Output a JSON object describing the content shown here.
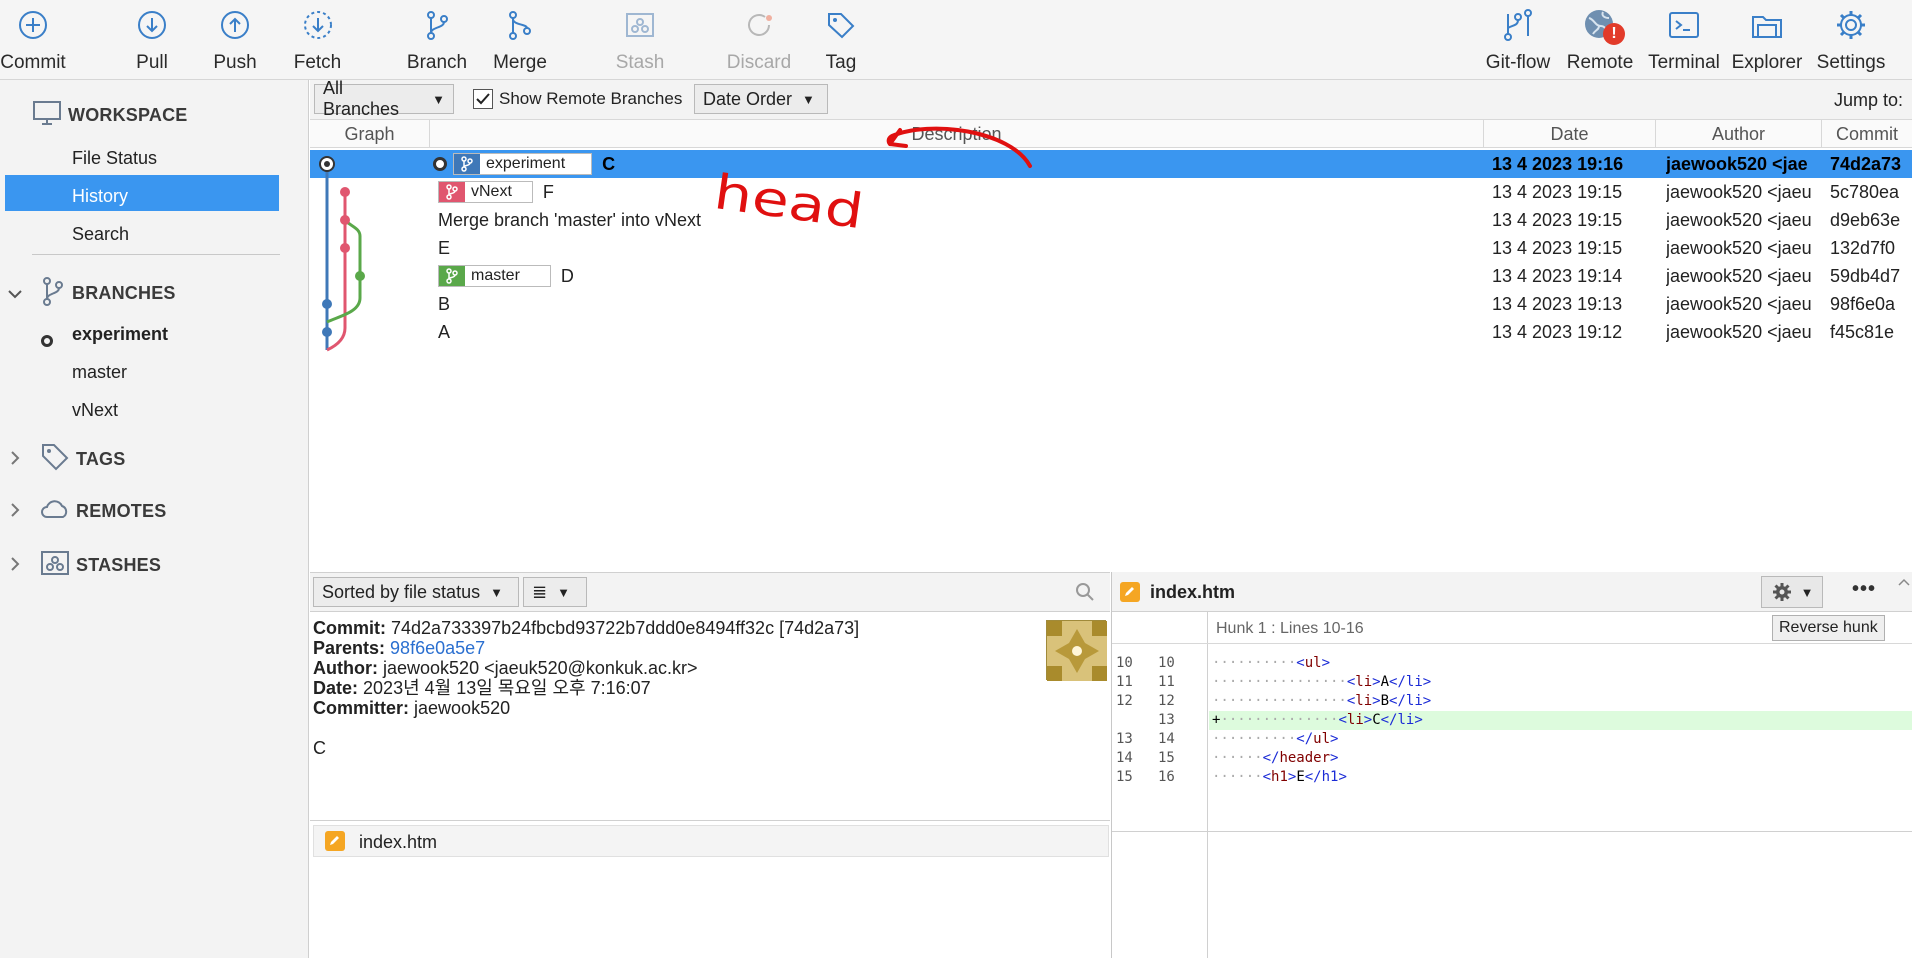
{
  "toolbar": {
    "buttons": [
      {
        "label": "Commit",
        "icon": "plus-circle-icon"
      },
      {
        "label": "Pull",
        "icon": "arrow-down-circle-icon"
      },
      {
        "label": "Push",
        "icon": "arrow-up-circle-icon"
      },
      {
        "label": "Fetch",
        "icon": "dashed-arrow-down-circle-icon"
      },
      {
        "label": "Branch",
        "icon": "branch-icon"
      },
      {
        "label": "Merge",
        "icon": "merge-icon"
      },
      {
        "label": "Stash",
        "icon": "stash-icon"
      },
      {
        "label": "Discard",
        "icon": "discard-icon"
      },
      {
        "label": "Tag",
        "icon": "tag-icon"
      },
      {
        "label": "Git-flow",
        "icon": "git-flow-icon"
      },
      {
        "label": "Remote",
        "icon": "globe-icon"
      },
      {
        "label": "Terminal",
        "icon": "terminal-icon"
      },
      {
        "label": "Explorer",
        "icon": "folder-icon"
      },
      {
        "label": "Settings",
        "icon": "gear-icon"
      }
    ],
    "remote_badge": "!"
  },
  "sidebar": {
    "workspace": "WORKSPACE",
    "workspace_items": [
      "File Status",
      "History",
      "Search"
    ],
    "branches": "BRANCHES",
    "branch_items": [
      "experiment",
      "master",
      "vNext"
    ],
    "tags": "TAGS",
    "remotes": "REMOTES",
    "stashes": "STASHES"
  },
  "filter": {
    "branches": "All Branches",
    "show_remote": "Show Remote Branches",
    "order": "Date Order",
    "jump_to": "Jump to:"
  },
  "history": {
    "columns": [
      "Graph",
      "Description",
      "Date",
      "Author",
      "Commit"
    ],
    "rows": [
      {
        "branch": "experiment",
        "desc": "C",
        "date": "13 4 2023 19:16",
        "author": "jaewook520 <jae",
        "commit": "74d2a73"
      },
      {
        "branch": "vNext",
        "desc": "F",
        "date": "13 4 2023 19:15",
        "author": "jaewook520 <jaeu",
        "commit": "5c780ea"
      },
      {
        "branch": "",
        "desc": "Merge branch 'master' into vNext",
        "date": "13 4 2023 19:15",
        "author": "jaewook520 <jaeu",
        "commit": "d9eb63e"
      },
      {
        "branch": "",
        "desc": "E",
        "date": "13 4 2023 19:15",
        "author": "jaewook520 <jaeu",
        "commit": "132d7f0"
      },
      {
        "branch": "master",
        "desc": "D",
        "date": "13 4 2023 19:14",
        "author": "jaewook520 <jaeu",
        "commit": "59db4d7"
      },
      {
        "branch": "",
        "desc": "B",
        "date": "13 4 2023 19:13",
        "author": "jaewook520 <jaeu",
        "commit": "98f6e0a"
      },
      {
        "branch": "",
        "desc": "A",
        "date": "13 4 2023 19:12",
        "author": "jaewook520 <jaeu",
        "commit": "f45c81e"
      }
    ],
    "annotation": "head"
  },
  "filebar": {
    "sort": "Sorted by file status",
    "view": "≣"
  },
  "commit_details": {
    "commit_label": "Commit:",
    "commit_value": "74d2a733397b24fbcbd93722b7ddd0e8494ff32c [74d2a73]",
    "parents_label": "Parents:",
    "parents_value": "98f6e0a5e7",
    "author_label": "Author:",
    "author_value": "jaewook520 <jaeuk520@konkuk.ac.kr>",
    "date_label": "Date:",
    "date_value": "2023년 4월 13일 목요일 오후 7:16:07",
    "committer_label": "Committer:",
    "committer_value": "jaewook520",
    "message": "C"
  },
  "changed_files": [
    "index.htm"
  ],
  "diff": {
    "file": "index.htm",
    "hunk": "Hunk 1 : Lines 10-16",
    "reverse": "Reverse hunk",
    "more": "•••",
    "lines": [
      {
        "old": "10",
        "new": "10",
        "dots": "··········",
        "open": "<",
        "tag": "ul",
        "close": ">",
        "text": "",
        "etag": "",
        "added": false,
        "plus": ""
      },
      {
        "old": "11",
        "new": "11",
        "dots": "················",
        "open": "<",
        "tag": "li",
        "close": ">",
        "text": "A",
        "etag": "</li>",
        "added": false,
        "plus": ""
      },
      {
        "old": "12",
        "new": "12",
        "dots": "················",
        "open": "<",
        "tag": "li",
        "close": ">",
        "text": "B",
        "etag": "</li>",
        "added": false,
        "plus": ""
      },
      {
        "old": "",
        "new": "13",
        "dots": "··············",
        "open": "<",
        "tag": "li",
        "close": ">",
        "text": "C",
        "etag": "</li>",
        "added": true,
        "plus": "+"
      },
      {
        "old": "13",
        "new": "14",
        "dots": "··········",
        "open": "</",
        "tag": "ul",
        "close": ">",
        "text": "",
        "etag": "",
        "added": false,
        "plus": ""
      },
      {
        "old": "14",
        "new": "15",
        "dots": "······",
        "open": "</",
        "tag": "header",
        "close": ">",
        "text": "",
        "etag": "",
        "added": false,
        "plus": ""
      },
      {
        "old": "15",
        "new": "16",
        "dots": "······",
        "open": "<",
        "tag": "h1",
        "close": ">",
        "text": "E",
        "etag": "</h1>",
        "added": false,
        "plus": ""
      }
    ]
  },
  "colors": {
    "selection": "#3a96f0",
    "branch_experiment": "#3f78b8",
    "branch_vnext": "#e0566f",
    "branch_master": "#5aa84a",
    "annotation": "#e01010"
  }
}
